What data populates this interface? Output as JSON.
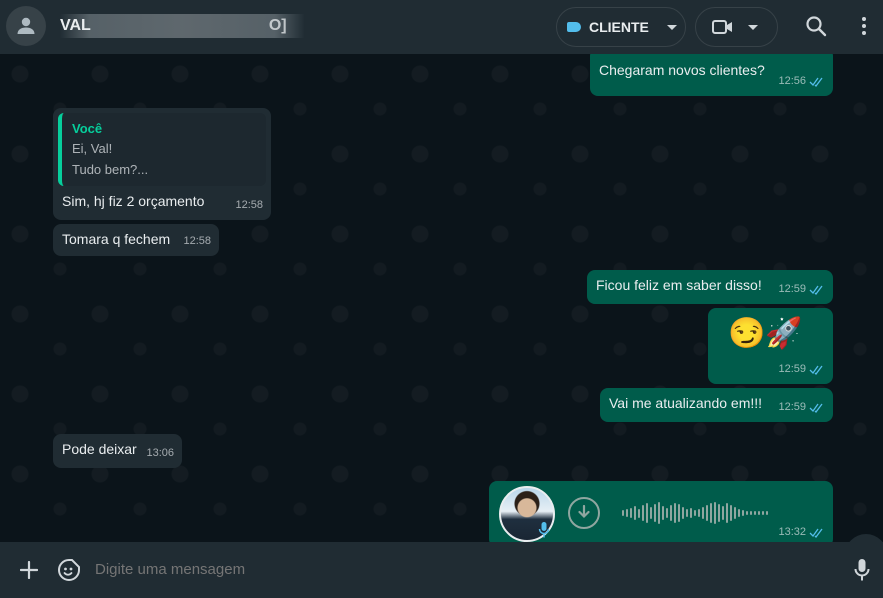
{
  "header": {
    "contact_name": "VAL",
    "contact_name_tail": "O]",
    "label_text": "CLIENTE",
    "icons": [
      "avatar-icon",
      "label-tag-icon",
      "video-camera-icon",
      "search-icon",
      "menu-dots-icon"
    ]
  },
  "messages": {
    "m1": {
      "text": "Chegaram novos clientes?",
      "time": "12:56"
    },
    "m2": {
      "quote_author": "Você",
      "quote_line1": "Ei, Val!",
      "quote_line2": "Tudo bem?...",
      "text": "Sim, hj fiz 2 orçamento",
      "time": "12:58"
    },
    "m3": {
      "text": "Tomara q fechem",
      "time": "12:58"
    },
    "m4": {
      "text": "Ficou feliz em saber disso!",
      "time": "12:59"
    },
    "m5": {
      "emoji": "😏🚀",
      "time": "12:59"
    },
    "m6": {
      "text": "Vai me atualizando em!!!",
      "time": "12:59"
    },
    "m7": {
      "text": "Pode deixar",
      "time": "13:06"
    },
    "m8": {
      "time": "13:32"
    }
  },
  "composer": {
    "placeholder": "Digite uma mensagem"
  },
  "colors": {
    "outgoing_bubble": "#005c4b",
    "incoming_bubble": "#202c33",
    "accent": "#06cf9c",
    "read_ticks": "#53bdeb"
  }
}
